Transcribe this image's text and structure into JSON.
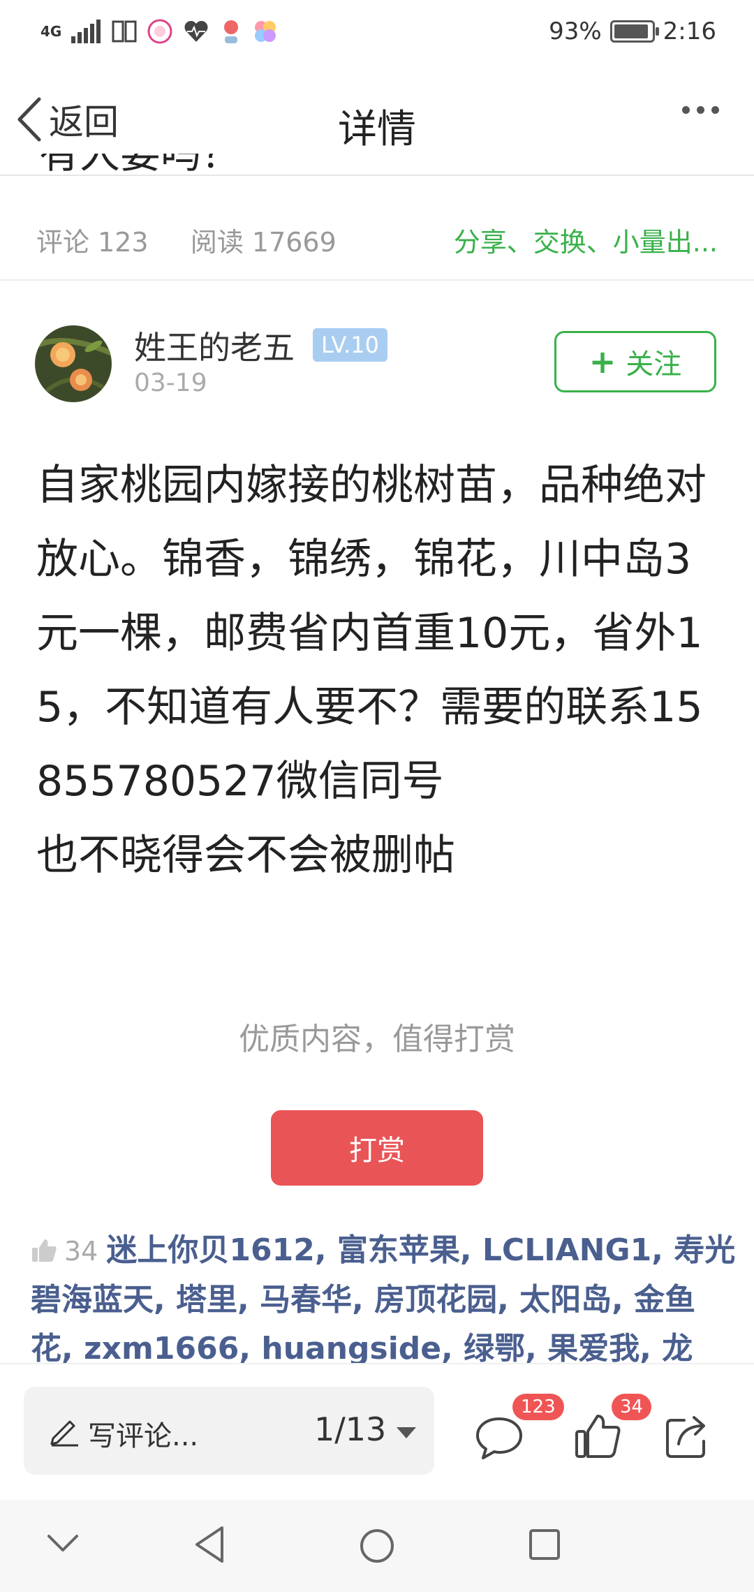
{
  "status_bar": {
    "network": "4G",
    "battery_percent": "93%",
    "battery_level": 0.93,
    "time": "2:16"
  },
  "nav": {
    "back_label": "返回",
    "title": "详情"
  },
  "prev_post": {
    "cutoff_text": "有人要吗？",
    "comments": "评论 123",
    "reads": "阅读 17669",
    "category": "分享、交换、小量出..."
  },
  "author": {
    "name": "姓王的老五",
    "level": "LV.10",
    "date": "03-19",
    "follow_label": "关注"
  },
  "post": {
    "paragraphs": [
      "自家桃园内嫁接的桃树苗，品种绝对放心。锦香，锦绣，锦花，川中岛3元一棵，邮费省内首重10元，省外15，不知道有人要不？需要的联系15855780527微信同号",
      "也不晓得会不会被删帖"
    ]
  },
  "reward": {
    "prompt": "优质内容，值得打赏",
    "button_label": "打赏"
  },
  "likes": {
    "count": "34",
    "users": "迷上你贝1612, 富东苹果, LCLIANG1, 寿光碧海蓝天, 塔里, 马春华, 房顶花园, 太阳岛, 金鱼花, zxm1666, huangside, 绿鄂, 果爱我, 龙"
  },
  "action_bar": {
    "comment_placeholder": "写评论...",
    "page_indicator": "1/13",
    "comment_badge": "123",
    "like_badge": "34"
  },
  "icons": {
    "back": "chevron-left-icon",
    "more": "more-dots-icon",
    "pencil": "pencil-icon",
    "comment": "comment-bubble-icon",
    "like": "thumbs-up-icon",
    "share": "share-icon"
  },
  "colors": {
    "accent_green": "#3ab14a",
    "reward_red": "#e95557",
    "liker_blue": "#4a5f8f",
    "badge_red": "#f05555"
  }
}
